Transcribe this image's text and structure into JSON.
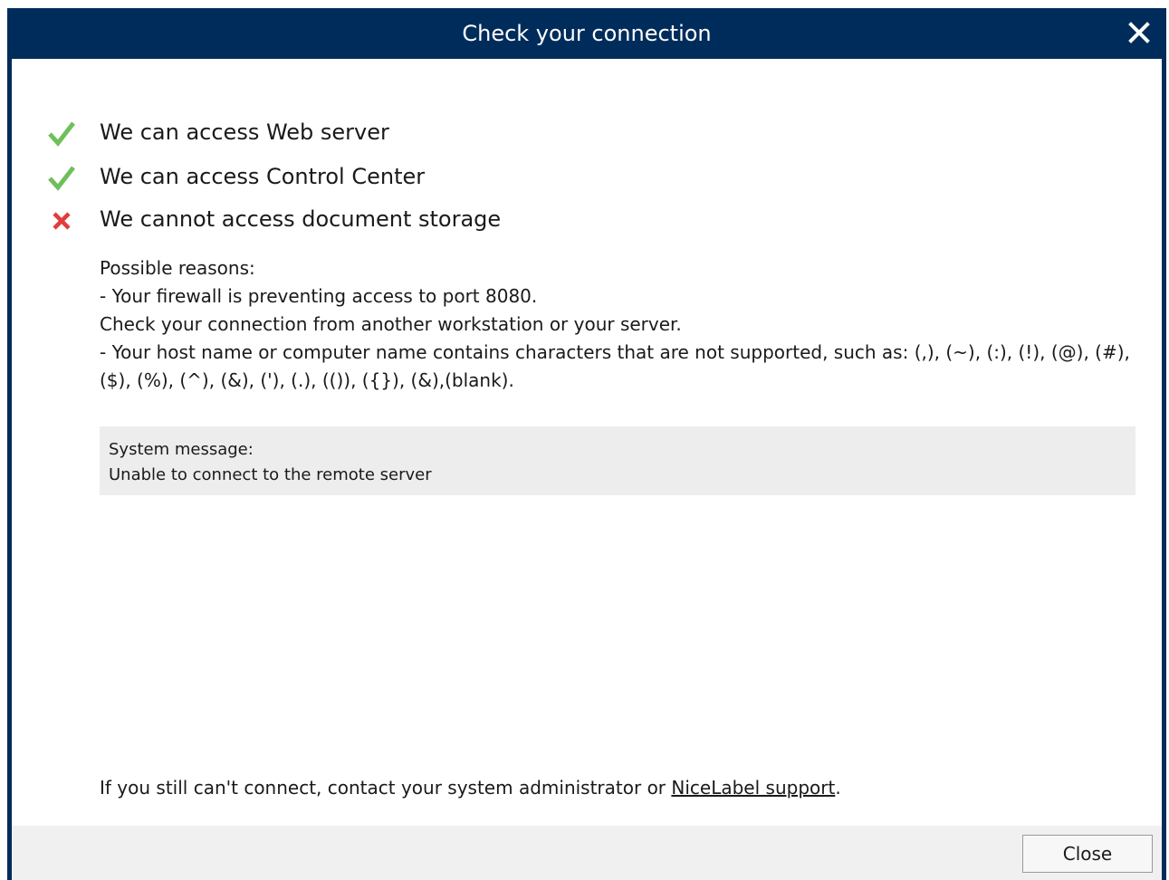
{
  "dialog": {
    "title": "Check your connection",
    "close_icon": "close-icon"
  },
  "status": [
    {
      "icon": "checkmark-icon",
      "state": "ok",
      "color": "#6fbf5a",
      "text": "We can access Web server"
    },
    {
      "icon": "checkmark-icon",
      "state": "ok",
      "color": "#6fbf5a",
      "text": "We can access Control Center"
    },
    {
      "icon": "cross-icon",
      "state": "error",
      "color": "#e23b3b",
      "text": "We cannot access document storage"
    }
  ],
  "reasons": {
    "heading": "Possible reasons:",
    "line1": "- Your firewall is preventing access to port 8080.",
    "line2": "Check your connection from another workstation or your server.",
    "line3": "- Your host name or computer name contains characters that are not supported, such as: (,), (~), (:), (!), (@), (#),",
    "line4": "($), (%), (^), (&), ('), (.), (()), ({}), (&),(blank)."
  },
  "system_message": {
    "label": "System message:",
    "text": "Unable to connect to the remote server"
  },
  "footer": {
    "text_before": "If you still can't connect, contact your system administrator or ",
    "link_text": "NiceLabel support",
    "text_after": "."
  },
  "buttons": {
    "close_label": "Close"
  },
  "colors": {
    "titlebar": "#002c5b",
    "ok": "#6fbf5a",
    "error": "#e23b3b"
  }
}
